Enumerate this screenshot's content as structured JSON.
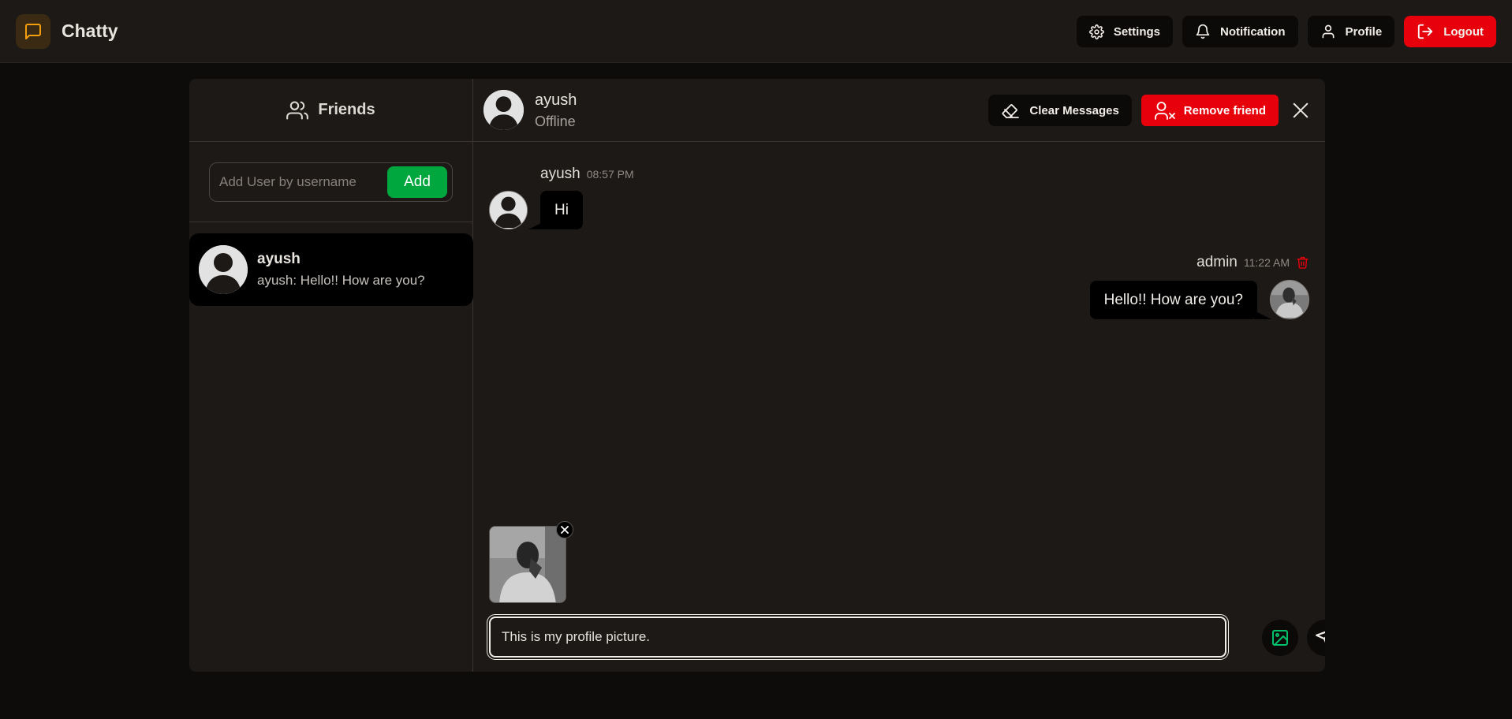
{
  "app": {
    "name": "Chatty",
    "accent": "#f59e0b",
    "danger": "#e7000b",
    "success": "#00a63e"
  },
  "nav": {
    "settings": "Settings",
    "notification": "Notification",
    "profile": "Profile",
    "logout": "Logout"
  },
  "sidebar": {
    "title": "Friends",
    "add_placeholder": "Add User by username",
    "add_label": "Add",
    "friends": [
      {
        "name": "ayush",
        "last_message": "ayush: Hello!! How are you?"
      }
    ]
  },
  "chat": {
    "contact_name": "ayush",
    "contact_status": "Offline",
    "clear_label": "Clear Messages",
    "remove_label": "Remove friend",
    "messages": [
      {
        "sender": "ayush",
        "time": "08:57 PM",
        "text": "Hi",
        "direction": "incoming"
      },
      {
        "sender": "admin",
        "time": "11:22 AM",
        "text": "Hello!! How are you?",
        "direction": "outgoing"
      }
    ],
    "composer_value": "This is my profile picture."
  },
  "icons": {
    "logo": "message-square-icon",
    "settings": "gear-icon",
    "notification": "bell-icon",
    "profile": "user-icon",
    "logout": "logout-icon",
    "friends": "users-icon",
    "clear": "eraser-icon",
    "remove": "user-x-icon",
    "close": "close-icon",
    "delete": "trash-icon",
    "attach": "image-icon",
    "send": "send-icon"
  }
}
